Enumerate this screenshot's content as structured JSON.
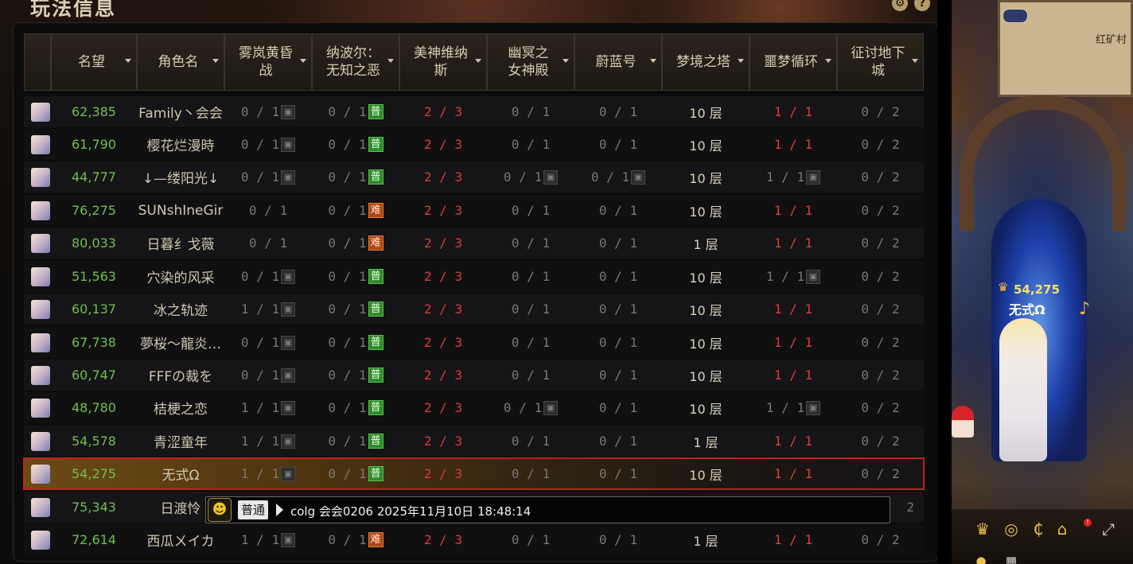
{
  "panel": {
    "title": "玩法信息",
    "settings_icon": "gear-icon",
    "help_icon": "question-icon"
  },
  "columns": [
    {
      "key": "renown",
      "label": "名望"
    },
    {
      "key": "name",
      "label": "角色名"
    },
    {
      "key": "c1",
      "label": "雾岚黄昏\n战"
    },
    {
      "key": "c2",
      "label": "纳波尔：\n无知之恶"
    },
    {
      "key": "c3",
      "label": "美神维纳\n斯"
    },
    {
      "key": "c4",
      "label": "幽冥之\n女神殿"
    },
    {
      "key": "c5",
      "label": "蔚蓝号"
    },
    {
      "key": "c6",
      "label": "梦境之塔"
    },
    {
      "key": "c7",
      "label": "噩梦循环"
    },
    {
      "key": "c8",
      "label": "征讨地下\n城"
    }
  ],
  "rows": [
    {
      "renown": "62,385",
      "name": "Family丶会会",
      "c1": "0 / 1",
      "c1_lock": true,
      "c2": "0 / 1",
      "c2_badge": "普",
      "c2_badge_type": "green",
      "c3": "2 / 3",
      "c4": "0 / 1",
      "c4_lock": false,
      "c5": "0 / 1",
      "c5_lock": false,
      "c6": "10 层",
      "c7": "1 / 1",
      "c7_red": true,
      "c7_lock": false,
      "c8": "0 / 2"
    },
    {
      "renown": "61,790",
      "name": "樱花烂漫時",
      "c1": "0 / 1",
      "c1_lock": true,
      "c2": "0 / 1",
      "c2_badge": "普",
      "c2_badge_type": "green",
      "c3": "2 / 3",
      "c4": "0 / 1",
      "c4_lock": false,
      "c5": "0 / 1",
      "c5_lock": false,
      "c6": "10 层",
      "c7": "1 / 1",
      "c7_red": true,
      "c7_lock": false,
      "c8": "0 / 2"
    },
    {
      "renown": "44,777",
      "name": "↓—缕阳光↓",
      "c1": "0 / 1",
      "c1_lock": true,
      "c2": "0 / 1",
      "c2_badge": "普",
      "c2_badge_type": "green",
      "c3": "2 / 3",
      "c4": "0 / 1",
      "c4_lock": true,
      "c5": "0 / 1",
      "c5_lock": true,
      "c6": "10 层",
      "c7": "1 / 1",
      "c7_red": false,
      "c7_lock": true,
      "c8": "0 / 2"
    },
    {
      "renown": "76,275",
      "name": "SUNshIneGir",
      "c1": "0 / 1",
      "c1_lock": false,
      "c2": "0 / 1",
      "c2_badge": "难",
      "c2_badge_type": "orange",
      "c3": "2 / 3",
      "c4": "0 / 1",
      "c4_lock": false,
      "c5": "0 / 1",
      "c5_lock": false,
      "c6": "10 层",
      "c7": "1 / 1",
      "c7_red": true,
      "c7_lock": false,
      "c8": "0 / 2"
    },
    {
      "renown": "80,033",
      "name": "日暮纟戈薇",
      "c1": "0 / 1",
      "c1_lock": false,
      "c2": "0 / 1",
      "c2_badge": "难",
      "c2_badge_type": "orange",
      "c3": "2 / 3",
      "c4": "0 / 1",
      "c4_lock": false,
      "c5": "0 / 1",
      "c5_lock": false,
      "c6": "1 层",
      "c7": "1 / 1",
      "c7_red": true,
      "c7_lock": false,
      "c8": "0 / 2"
    },
    {
      "renown": "51,563",
      "name": "穴染的风采",
      "c1": "0 / 1",
      "c1_lock": true,
      "c2": "0 / 1",
      "c2_badge": "普",
      "c2_badge_type": "green",
      "c3": "2 / 3",
      "c4": "0 / 1",
      "c4_lock": false,
      "c5": "0 / 1",
      "c5_lock": false,
      "c6": "10 层",
      "c7": "1 / 1",
      "c7_red": false,
      "c7_lock": true,
      "c8": "0 / 2"
    },
    {
      "renown": "60,137",
      "name": "冰之轨迹",
      "c1": "1 / 1",
      "c1_lock": true,
      "c2": "0 / 1",
      "c2_badge": "普",
      "c2_badge_type": "green",
      "c3": "2 / 3",
      "c4": "0 / 1",
      "c4_lock": false,
      "c5": "0 / 1",
      "c5_lock": false,
      "c6": "10 层",
      "c7": "1 / 1",
      "c7_red": true,
      "c7_lock": false,
      "c8": "0 / 2"
    },
    {
      "renown": "67,738",
      "name": "夢桜～龍炎…",
      "c1": "0 / 1",
      "c1_lock": true,
      "c2": "0 / 1",
      "c2_badge": "普",
      "c2_badge_type": "green",
      "c3": "2 / 3",
      "c4": "0 / 1",
      "c4_lock": false,
      "c5": "0 / 1",
      "c5_lock": false,
      "c6": "10 层",
      "c7": "1 / 1",
      "c7_red": true,
      "c7_lock": false,
      "c8": "0 / 2"
    },
    {
      "renown": "60,747",
      "name": "FFFの裁を",
      "c1": "0 / 1",
      "c1_lock": true,
      "c2": "0 / 1",
      "c2_badge": "普",
      "c2_badge_type": "green",
      "c3": "2 / 3",
      "c4": "0 / 1",
      "c4_lock": false,
      "c5": "0 / 1",
      "c5_lock": false,
      "c6": "10 层",
      "c7": "1 / 1",
      "c7_red": true,
      "c7_lock": false,
      "c8": "0 / 2"
    },
    {
      "renown": "48,780",
      "name": "桔梗之恋",
      "c1": "1 / 1",
      "c1_lock": true,
      "c2": "0 / 1",
      "c2_badge": "普",
      "c2_badge_type": "green",
      "c3": "2 / 3",
      "c4": "0 / 1",
      "c4_lock": true,
      "c5": "0 / 1",
      "c5_lock": false,
      "c6": "10 层",
      "c7": "1 / 1",
      "c7_red": false,
      "c7_lock": true,
      "c8": "0 / 2"
    },
    {
      "renown": "54,578",
      "name": "青涩童年",
      "c1": "1 / 1",
      "c1_lock": true,
      "c2": "0 / 1",
      "c2_badge": "普",
      "c2_badge_type": "green",
      "c3": "2 / 3",
      "c4": "0 / 1",
      "c4_lock": false,
      "c5": "0 / 1",
      "c5_lock": false,
      "c6": "1 层",
      "c7": "1 / 1",
      "c7_red": true,
      "c7_lock": false,
      "c8": "0 / 2"
    },
    {
      "renown": "54,275",
      "name": "无式Ω",
      "c1": "1 / 1",
      "c1_lock": true,
      "c2": "0 / 1",
      "c2_badge": "普",
      "c2_badge_type": "green",
      "c3": "2 / 3",
      "c4": "0 / 1",
      "c4_lock": false,
      "c5": "0 / 1",
      "c5_lock": false,
      "c6": "10 层",
      "c7": "1 / 1",
      "c7_red": true,
      "c7_lock": false,
      "c8": "0 / 2",
      "selected": true
    },
    {
      "renown": "75,343",
      "name": "日渡怜",
      "c1": "",
      "c1_lock": false,
      "c2": "",
      "c2_badge": "",
      "c2_badge_type": "",
      "c3": "",
      "c4": "",
      "c4_lock": false,
      "c5": "",
      "c5_lock": false,
      "c6": "",
      "c7": "",
      "c7_red": false,
      "c7_lock": false,
      "c8": "2",
      "partial": true
    },
    {
      "renown": "72,614",
      "name": "西瓜ㄨイカ",
      "c1": "1 / 1",
      "c1_lock": true,
      "c2": "0 / 1",
      "c2_badge": "难",
      "c2_badge_type": "orange",
      "c3": "2 / 3",
      "c4": "0 / 1",
      "c4_lock": false,
      "c5": "0 / 1",
      "c5_lock": false,
      "c6": "1 层",
      "c7": "1 / 1",
      "c7_red": true,
      "c7_lock": false,
      "c8": "0 / 2"
    }
  ],
  "chat": {
    "emoji_icon": "emoji-face-icon",
    "channel": "普通",
    "message": "colg 会会0206 2025年11月10日 18:48:14"
  },
  "scene": {
    "minimap_label": "红矿村",
    "char_renown": "54,275",
    "char_name": "无式Ω",
    "bottom_icons": [
      "crown-icon",
      "coin-icon",
      "currency-c-icon",
      "house-icon",
      "expand-icon",
      "pin-icon",
      "grid-icon"
    ]
  },
  "colors": {
    "renown": "#6fbf4e",
    "red_value": "#e03a3a",
    "selected_border": "#c51f1f",
    "badge_green": "#2f8a2a",
    "badge_orange": "#b14516"
  }
}
